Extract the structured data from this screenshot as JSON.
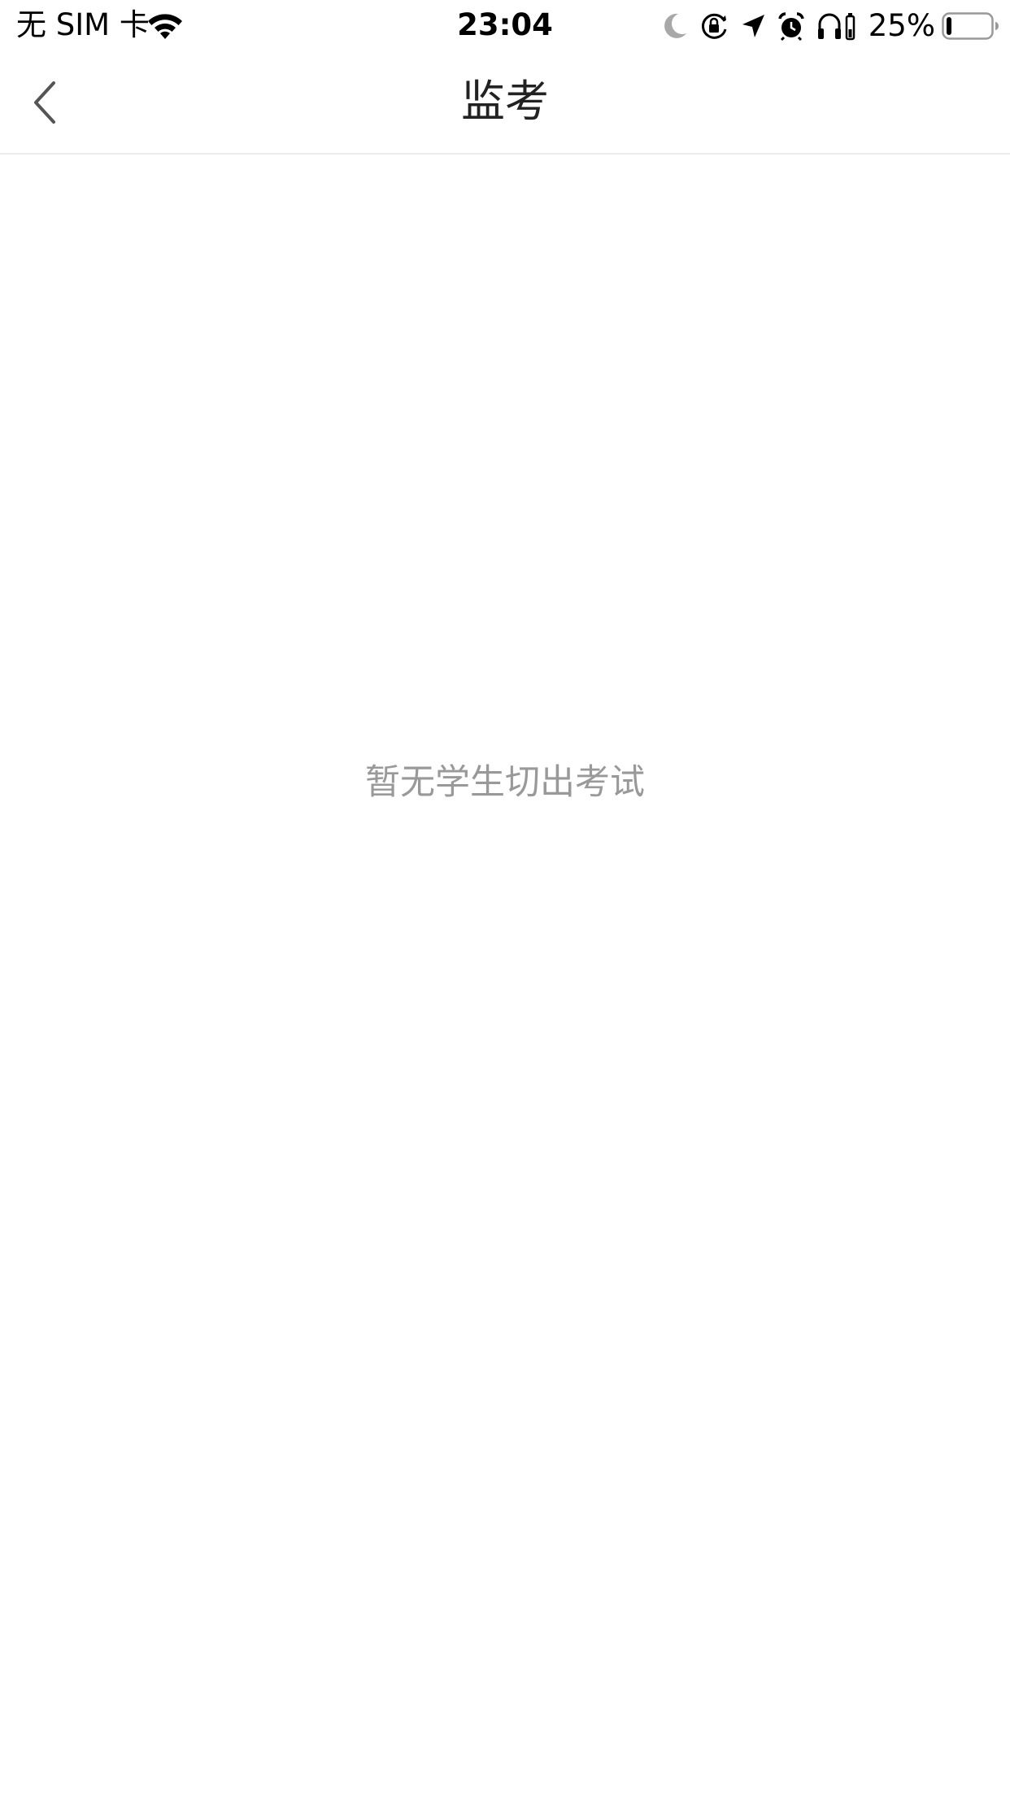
{
  "status_bar": {
    "carrier": "无 SIM 卡",
    "time": "23:04",
    "battery_percent": "25%",
    "battery_level": 0.25,
    "icons": [
      "wifi-icon",
      "moon-icon",
      "rotation-lock-icon",
      "location-icon",
      "alarm-icon",
      "headphones-icon",
      "battery-icon"
    ]
  },
  "nav": {
    "title": "监考",
    "back_icon": "chevron-left-icon"
  },
  "content": {
    "empty_message": "暂无学生切出考试"
  },
  "colors": {
    "background": "#ffffff",
    "title_text": "#222222",
    "empty_text": "#999999",
    "divider": "#ececec",
    "back_icon": "#555555"
  }
}
